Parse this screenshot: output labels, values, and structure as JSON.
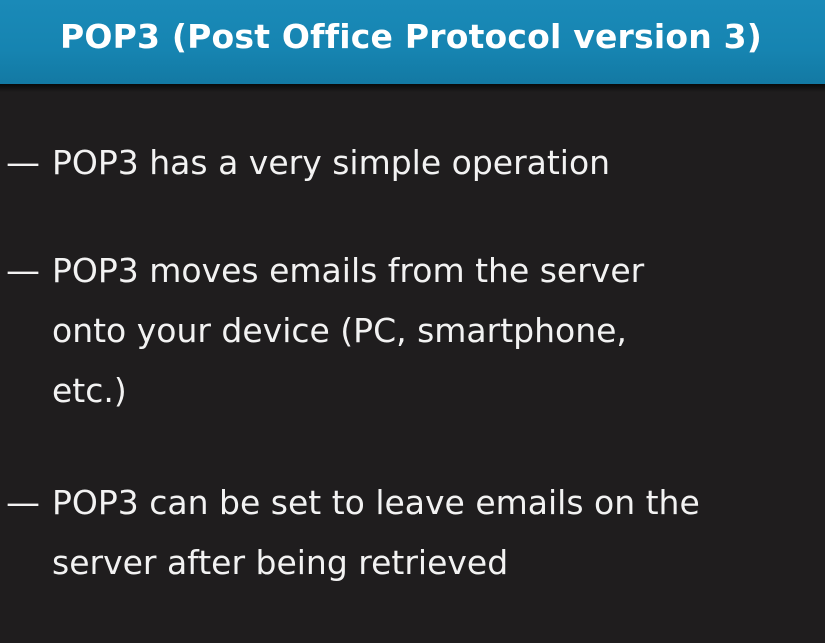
{
  "slide": {
    "title": "POP3 (Post Office Protocol version 3)",
    "bullet_marker": "—",
    "bullets": [
      {
        "lines": [
          "POP3 has a very simple operation"
        ]
      },
      {
        "lines": [
          "POP3 moves emails from the server",
          "onto your device (PC, smartphone,",
          "etc.)"
        ]
      },
      {
        "lines": [
          "POP3 can be set to leave emails on the",
          "server after being retrieved"
        ]
      }
    ],
    "colors": {
      "title_bar": "#1684b1",
      "background": "#1f1d1e",
      "text": "#f2f2f2"
    }
  }
}
